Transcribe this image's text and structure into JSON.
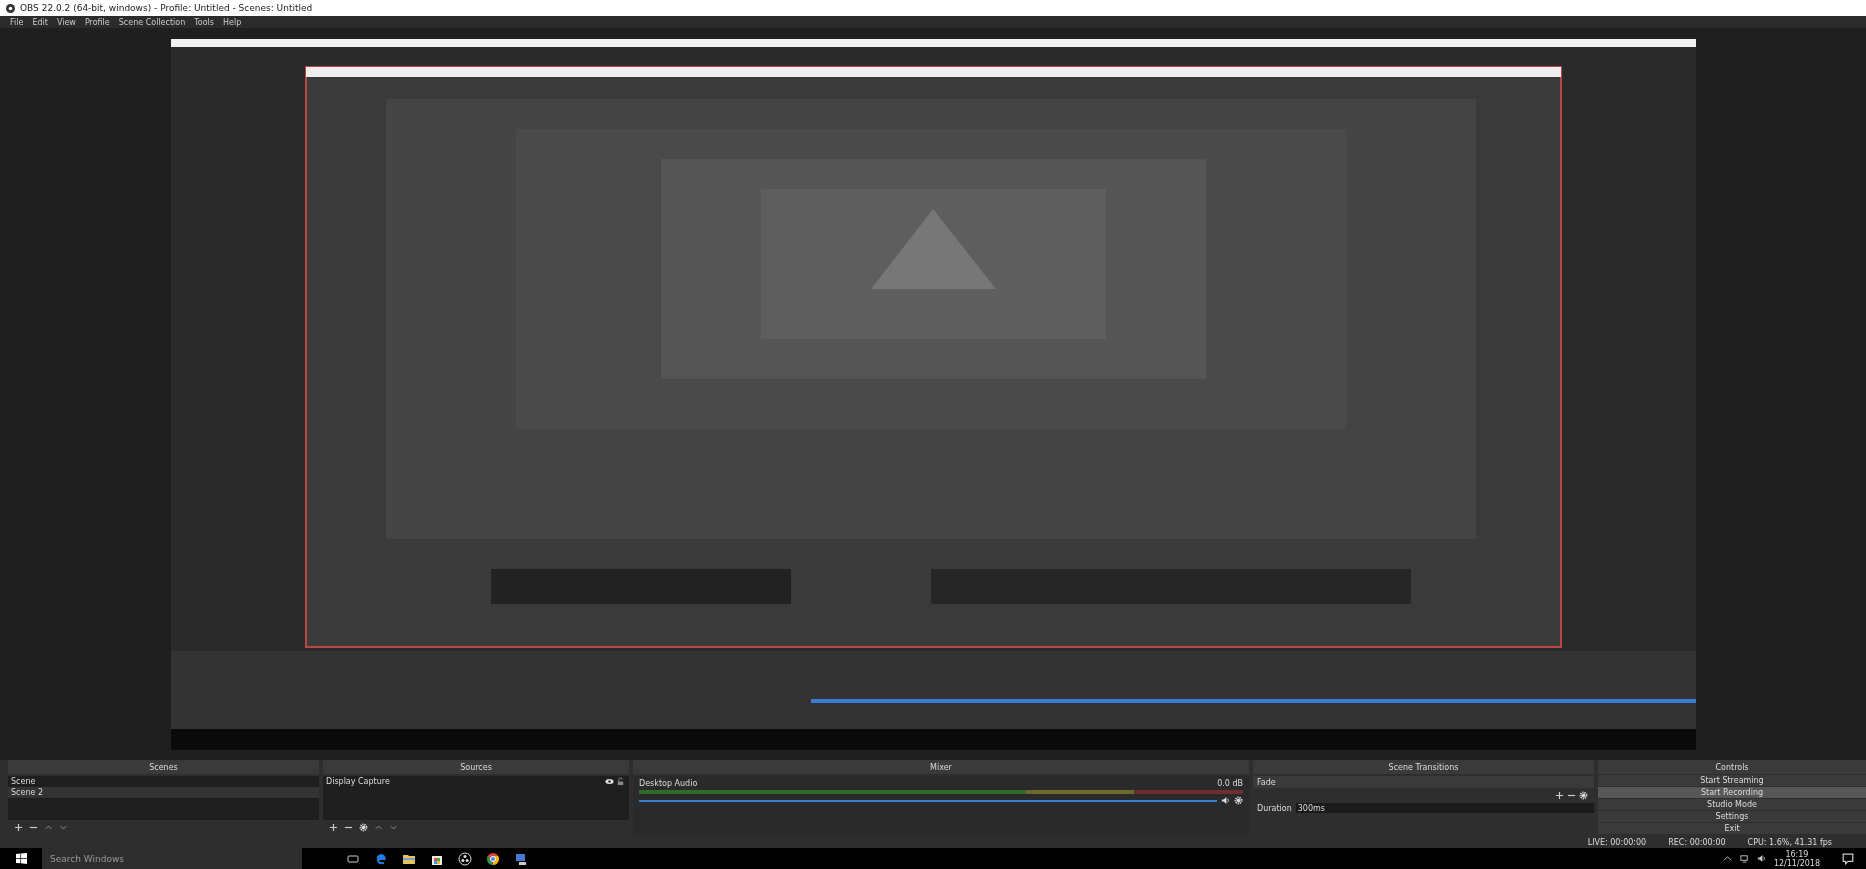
{
  "window": {
    "title": "OBS 22.0.2 (64-bit, windows) - Profile: Untitled - Scenes: Untitled"
  },
  "menu": [
    "File",
    "Edit",
    "View",
    "Profile",
    "Scene Collection",
    "Tools",
    "Help"
  ],
  "scenes": {
    "title": "Scenes",
    "items": [
      {
        "label": "Scene",
        "selected": false
      },
      {
        "label": "Scene 2",
        "selected": true
      }
    ]
  },
  "sources": {
    "title": "Sources",
    "items": [
      {
        "label": "Display Capture",
        "visible": true,
        "locked": false
      }
    ]
  },
  "mixer": {
    "title": "Mixer",
    "channels": [
      {
        "name": "Desktop Audio",
        "reading": "0.0 dB",
        "level": 1,
        "muted": false
      }
    ]
  },
  "transitions": {
    "title": "Scene Transitions",
    "transition": "Fade",
    "duration_label": "Duration",
    "duration": "300ms"
  },
  "controls": {
    "title": "Controls",
    "buttons": [
      {
        "label": "Start Streaming",
        "hovered": false
      },
      {
        "label": "Start Recording",
        "hovered": true
      },
      {
        "label": "Studio Mode",
        "hovered": false
      },
      {
        "label": "Settings",
        "hovered": false
      },
      {
        "label": "Exit",
        "hovered": false
      }
    ]
  },
  "status_bar": [
    "LIVE: 00:00:00",
    "REC: 00:00:00",
    "CPU: 1.6%, 41.31 fps"
  ],
  "taskbar": {
    "search": {
      "placeholder": "Search Windows"
    },
    "time": "16:19",
    "date": "12/11/2018"
  }
}
